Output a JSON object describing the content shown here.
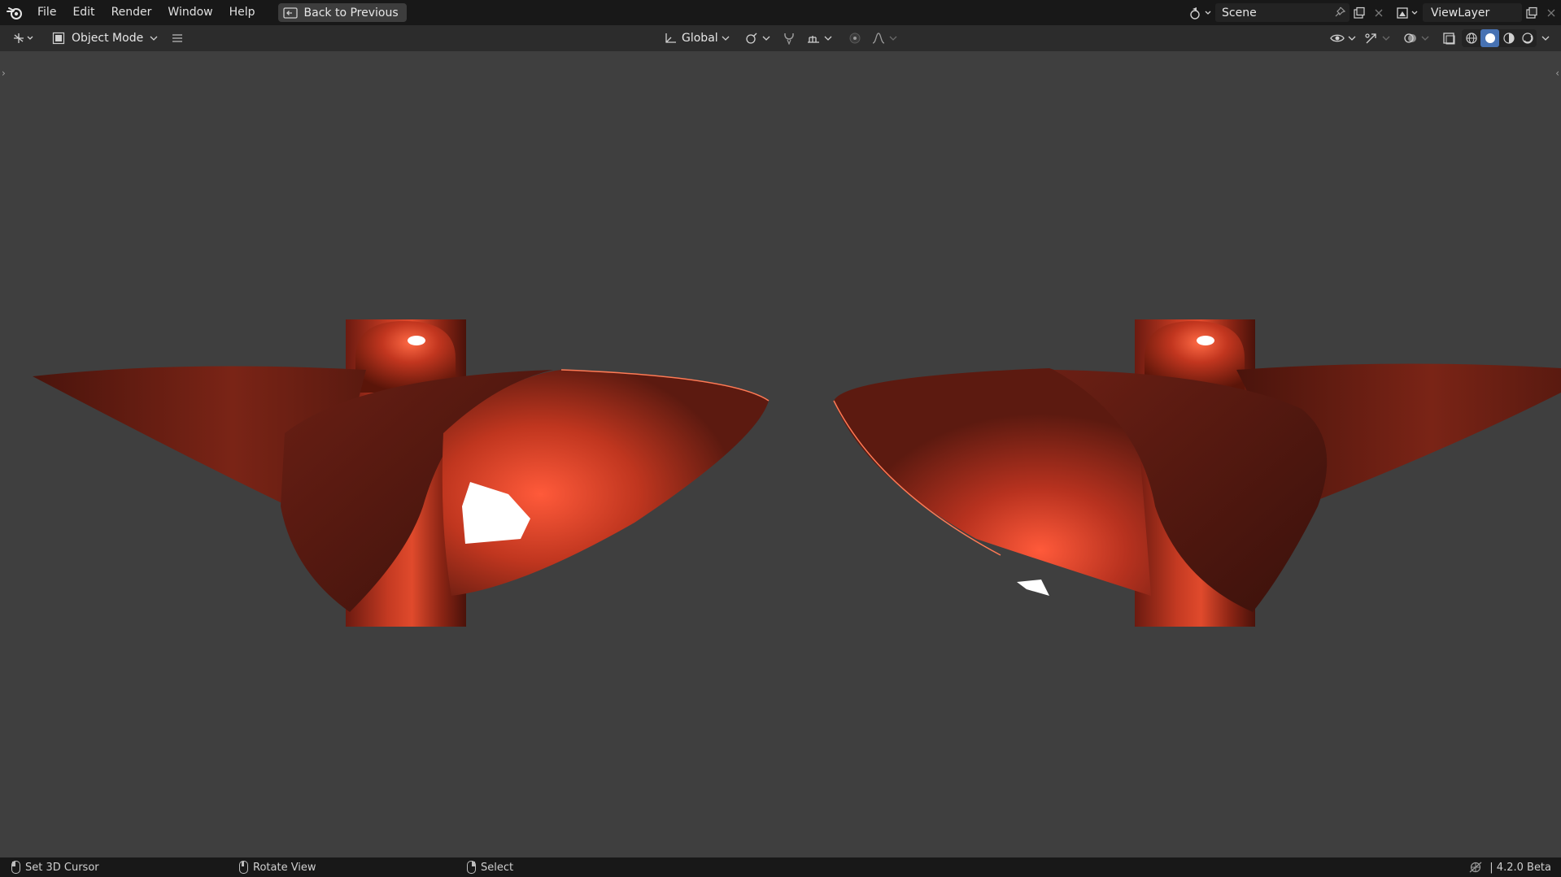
{
  "menubar": {
    "items": [
      "File",
      "Edit",
      "Render",
      "Window",
      "Help"
    ],
    "back_button": "Back to Previous"
  },
  "workspace": {
    "scene_name": "Scene",
    "view_layer_name": "ViewLayer"
  },
  "viewport_header": {
    "mode": "Object Mode",
    "transform_orientation": "Global",
    "shading_active": "solid"
  },
  "statusbar": {
    "left_click": "Set 3D Cursor",
    "middle_click": "Rotate View",
    "right_click": "Select",
    "version": "| 4.2.0 Beta"
  },
  "colors": {
    "accent": "#4772b3",
    "viewport_bg": "#3f3f3f",
    "object_color": "#b8321f"
  }
}
